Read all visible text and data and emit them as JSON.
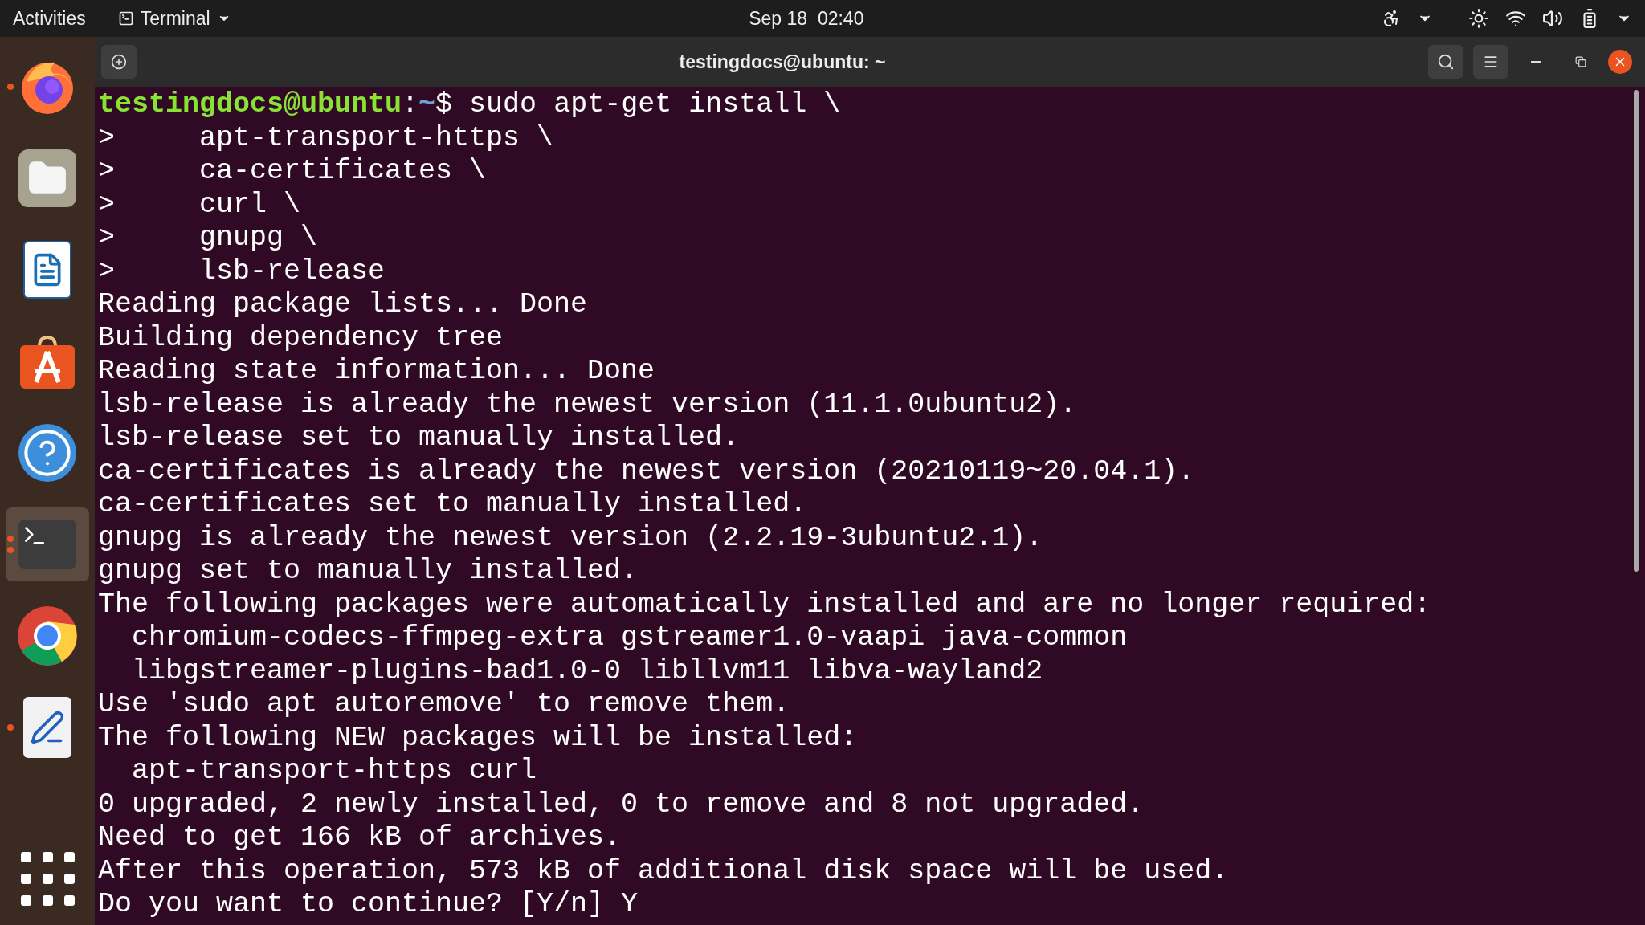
{
  "top_bar": {
    "activities": "Activities",
    "app_menu": "Terminal",
    "clock": "Sep 18  02:40"
  },
  "dock": {
    "items": [
      {
        "kind": "firefox",
        "running": true,
        "multiple_windows": false,
        "selected": false
      },
      {
        "kind": "files",
        "running": false,
        "multiple_windows": false,
        "selected": false
      },
      {
        "kind": "writer",
        "running": false,
        "multiple_windows": false,
        "selected": false
      },
      {
        "kind": "software",
        "running": false,
        "multiple_windows": false,
        "selected": false
      },
      {
        "kind": "help",
        "running": false,
        "multiple_windows": false,
        "selected": false
      },
      {
        "kind": "terminal",
        "running": true,
        "multiple_windows": true,
        "selected": true
      },
      {
        "kind": "chrome",
        "running": false,
        "multiple_windows": false,
        "selected": false
      },
      {
        "kind": "editor",
        "running": true,
        "multiple_windows": false,
        "selected": false
      }
    ]
  },
  "window": {
    "title": "testingdocs@ubuntu: ~"
  },
  "terminal": {
    "lines": [
      {
        "kind": "prompt",
        "user": "testingdocs@ubuntu",
        "sep": ":",
        "path": "~",
        "symbol": "$ ",
        "command": "sudo apt-get install \\"
      },
      {
        "kind": "text",
        "text": ">     apt-transport-https \\"
      },
      {
        "kind": "text",
        "text": ">     ca-certificates \\"
      },
      {
        "kind": "text",
        "text": ">     curl \\"
      },
      {
        "kind": "text",
        "text": ">     gnupg \\"
      },
      {
        "kind": "text",
        "text": ">     lsb-release"
      },
      {
        "kind": "text",
        "text": "Reading package lists... Done"
      },
      {
        "kind": "text",
        "text": "Building dependency tree"
      },
      {
        "kind": "text",
        "text": "Reading state information... Done"
      },
      {
        "kind": "text",
        "text": "lsb-release is already the newest version (11.1.0ubuntu2)."
      },
      {
        "kind": "text",
        "text": "lsb-release set to manually installed."
      },
      {
        "kind": "text",
        "text": "ca-certificates is already the newest version (20210119~20.04.1)."
      },
      {
        "kind": "text",
        "text": "ca-certificates set to manually installed."
      },
      {
        "kind": "text",
        "text": "gnupg is already the newest version (2.2.19-3ubuntu2.1)."
      },
      {
        "kind": "text",
        "text": "gnupg set to manually installed."
      },
      {
        "kind": "text",
        "text": "The following packages were automatically installed and are no longer required:"
      },
      {
        "kind": "text",
        "text": "  chromium-codecs-ffmpeg-extra gstreamer1.0-vaapi java-common"
      },
      {
        "kind": "text",
        "text": "  libgstreamer-plugins-bad1.0-0 libllvm11 libva-wayland2"
      },
      {
        "kind": "text",
        "text": "Use 'sudo apt autoremove' to remove them."
      },
      {
        "kind": "text",
        "text": "The following NEW packages will be installed:"
      },
      {
        "kind": "text",
        "text": "  apt-transport-https curl"
      },
      {
        "kind": "text",
        "text": "0 upgraded, 2 newly installed, 0 to remove and 8 not upgraded."
      },
      {
        "kind": "text",
        "text": "Need to get 166 kB of archives."
      },
      {
        "kind": "text",
        "text": "After this operation, 573 kB of additional disk space will be used."
      },
      {
        "kind": "text",
        "text": "Do you want to continue? [Y/n] Y"
      }
    ]
  }
}
